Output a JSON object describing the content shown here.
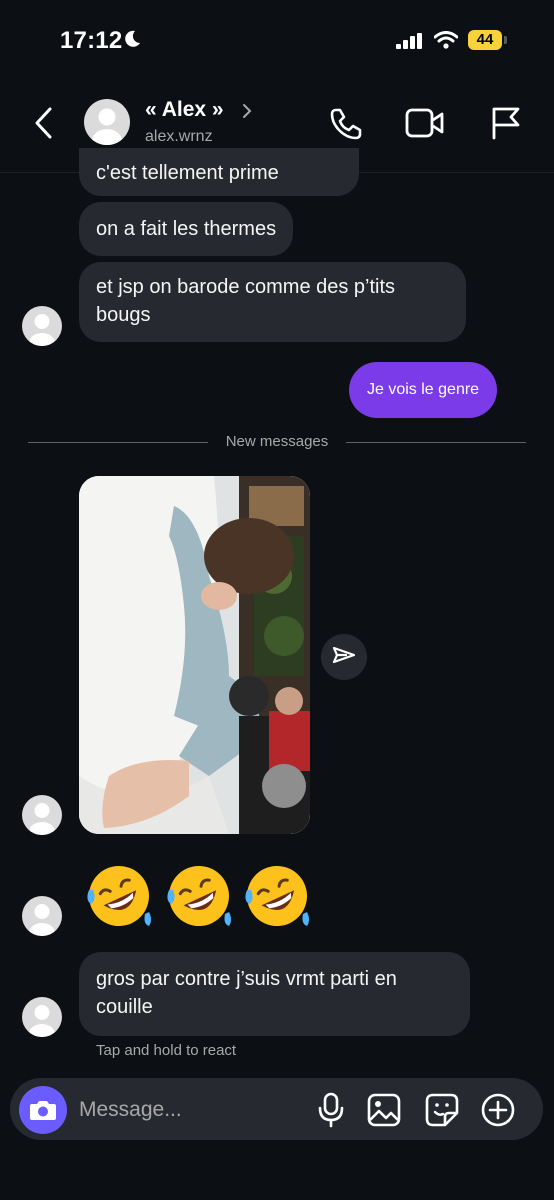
{
  "status_bar": {
    "time": "17:12",
    "battery": "44",
    "icons": [
      "moon-icon",
      "signal-icon",
      "wifi-icon",
      "battery-icon"
    ]
  },
  "header": {
    "name": "« Alex »",
    "username": "alex.wrnz",
    "icons": [
      "back-icon",
      "phone-icon",
      "video-icon",
      "flag-icon"
    ]
  },
  "messages": {
    "partial_top": "c'est tellement prime",
    "thermes": "on a fait les thermes",
    "barode": "et jsp on barode comme des p’tits bougs",
    "mine": "Je vois le genre",
    "gros": "gros par contre j’suis vrmt parti en couille",
    "emoji_count": 3
  },
  "divider": {
    "label": "New messages"
  },
  "react_hint": "Tap and hold to react",
  "composer": {
    "placeholder": "Message...",
    "icons": [
      "camera-icon",
      "mic-icon",
      "gallery-icon",
      "sticker-icon",
      "plus-icon"
    ]
  },
  "colors": {
    "background": "#0c1014",
    "bubble_received": "#262a30",
    "bubble_sent": "#7c3be8",
    "camera_button": "#6a5cff",
    "battery": "#f7d23a"
  }
}
